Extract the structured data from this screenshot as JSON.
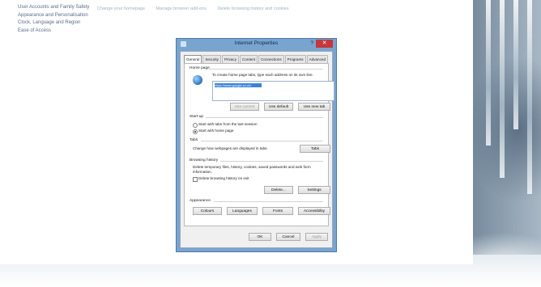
{
  "control_panel": {
    "left_links": [
      "User Accounts and Family Safety",
      "Appearance and Personalisation",
      "Clock, Language and Region",
      "Ease of Access"
    ],
    "top_links": [
      "Change your homepage",
      "Manage browser add-ons",
      "Delete browsing history and cookies"
    ]
  },
  "dialog": {
    "title": "Internet Properties",
    "help": "?",
    "close": "✕",
    "tabs": [
      "General",
      "Security",
      "Privacy",
      "Content",
      "Connections",
      "Programs",
      "Advanced"
    ],
    "home_page": {
      "label": "Home page",
      "instruction": "To create home page tabs, type each address on its own line.",
      "value": "https://www.google.co.uk/",
      "buttons": {
        "use_current": "Use current",
        "use_default": "Use default",
        "use_new_tab": "Use new tab"
      }
    },
    "startup": {
      "label": "Start-up",
      "options": [
        "Start with tabs from the last session",
        "Start with home page"
      ],
      "selected_index": 1
    },
    "tabs_group": {
      "label": "Tabs",
      "text": "Change how webpages are displayed in tabs.",
      "button": "Tabs"
    },
    "browsing_history": {
      "label": "Browsing history",
      "text": "Delete temporary files, history, cookies, saved passwords and web form information.",
      "checkbox": "Delete browsing history on exit",
      "checked": false,
      "delete_button": "Delete...",
      "settings_button": "Settings"
    },
    "appearance": {
      "label": "Appearance",
      "buttons": {
        "colours": "Colours",
        "languages": "Languages",
        "fonts": "Fonts",
        "accessibility": "Accessibility"
      }
    },
    "footer": {
      "ok": "OK",
      "cancel": "Cancel",
      "apply": "Apply"
    }
  }
}
